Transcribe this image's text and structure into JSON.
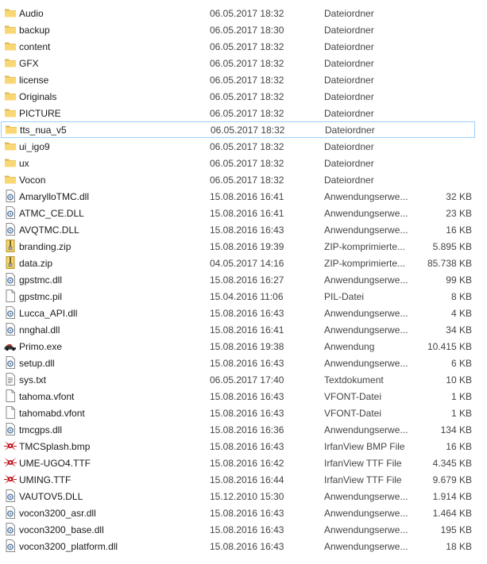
{
  "files": [
    {
      "name": "Audio",
      "date": "06.05.2017 18:32",
      "type": "Dateiordner",
      "size": "",
      "icon": "folder-icon"
    },
    {
      "name": "backup",
      "date": "06.05.2017 18:30",
      "type": "Dateiordner",
      "size": "",
      "icon": "folder-icon"
    },
    {
      "name": "content",
      "date": "06.05.2017 18:32",
      "type": "Dateiordner",
      "size": "",
      "icon": "folder-icon"
    },
    {
      "name": "GFX",
      "date": "06.05.2017 18:32",
      "type": "Dateiordner",
      "size": "",
      "icon": "folder-icon"
    },
    {
      "name": "license",
      "date": "06.05.2017 18:32",
      "type": "Dateiordner",
      "size": "",
      "icon": "folder-icon"
    },
    {
      "name": "Originals",
      "date": "06.05.2017 18:32",
      "type": "Dateiordner",
      "size": "",
      "icon": "folder-icon"
    },
    {
      "name": "PICTURE",
      "date": "06.05.2017 18:32",
      "type": "Dateiordner",
      "size": "",
      "icon": "folder-icon"
    },
    {
      "name": "tts_nua_v5",
      "date": "06.05.2017 18:32",
      "type": "Dateiordner",
      "size": "",
      "icon": "folder-icon",
      "selected": true
    },
    {
      "name": "ui_igo9",
      "date": "06.05.2017 18:32",
      "type": "Dateiordner",
      "size": "",
      "icon": "folder-icon"
    },
    {
      "name": "ux",
      "date": "06.05.2017 18:32",
      "type": "Dateiordner",
      "size": "",
      "icon": "folder-icon"
    },
    {
      "name": "Vocon",
      "date": "06.05.2017 18:32",
      "type": "Dateiordner",
      "size": "",
      "icon": "folder-icon"
    },
    {
      "name": "AmarylloTMC.dll",
      "date": "15.08.2016 16:41",
      "type": "Anwendungserwe...",
      "size": "32 KB",
      "icon": "dll-icon"
    },
    {
      "name": "ATMC_CE.DLL",
      "date": "15.08.2016 16:41",
      "type": "Anwendungserwe...",
      "size": "23 KB",
      "icon": "dll-icon"
    },
    {
      "name": "AVQTMC.DLL",
      "date": "15.08.2016 16:43",
      "type": "Anwendungserwe...",
      "size": "16 KB",
      "icon": "dll-icon"
    },
    {
      "name": "branding.zip",
      "date": "15.08.2016 19:39",
      "type": "ZIP-komprimierte...",
      "size": "5.895 KB",
      "icon": "zip-icon"
    },
    {
      "name": "data.zip",
      "date": "04.05.2017 14:16",
      "type": "ZIP-komprimierte...",
      "size": "85.738 KB",
      "icon": "zip-icon"
    },
    {
      "name": "gpstmc.dll",
      "date": "15.08.2016 16:27",
      "type": "Anwendungserwe...",
      "size": "99 KB",
      "icon": "dll-icon"
    },
    {
      "name": "gpstmc.pil",
      "date": "15.04.2016 11:06",
      "type": "PIL-Datei",
      "size": "8 KB",
      "icon": "file-icon"
    },
    {
      "name": "Lucca_API.dll",
      "date": "15.08.2016 16:43",
      "type": "Anwendungserwe...",
      "size": "4 KB",
      "icon": "dll-icon"
    },
    {
      "name": "nnghal.dll",
      "date": "15.08.2016 16:41",
      "type": "Anwendungserwe...",
      "size": "34 KB",
      "icon": "dll-icon"
    },
    {
      "name": "Primo.exe",
      "date": "15.08.2016 19:38",
      "type": "Anwendung",
      "size": "10.415 KB",
      "icon": "car-icon"
    },
    {
      "name": "setup.dll",
      "date": "15.08.2016 16:43",
      "type": "Anwendungserwe...",
      "size": "6 KB",
      "icon": "dll-icon"
    },
    {
      "name": "sys.txt",
      "date": "06.05.2017 17:40",
      "type": "Textdokument",
      "size": "10 KB",
      "icon": "text-file-icon"
    },
    {
      "name": "tahoma.vfont",
      "date": "15.08.2016 16:43",
      "type": "VFONT-Datei",
      "size": "1 KB",
      "icon": "file-icon"
    },
    {
      "name": "tahomabd.vfont",
      "date": "15.08.2016 16:43",
      "type": "VFONT-Datei",
      "size": "1 KB",
      "icon": "file-icon"
    },
    {
      "name": "tmcgps.dll",
      "date": "15.08.2016 16:36",
      "type": "Anwendungserwe...",
      "size": "134 KB",
      "icon": "dll-icon"
    },
    {
      "name": "TMCSplash.bmp",
      "date": "15.08.2016 16:43",
      "type": "IrfanView BMP File",
      "size": "16 KB",
      "icon": "irfanview-icon"
    },
    {
      "name": "UME-UGO4.TTF",
      "date": "15.08.2016 16:42",
      "type": "IrfanView TTF File",
      "size": "4.345 KB",
      "icon": "irfanview-icon"
    },
    {
      "name": "UMING.TTF",
      "date": "15.08.2016 16:44",
      "type": "IrfanView TTF File",
      "size": "9.679 KB",
      "icon": "irfanview-icon"
    },
    {
      "name": "VAUTOV5.DLL",
      "date": "15.12.2010 15:30",
      "type": "Anwendungserwe...",
      "size": "1.914 KB",
      "icon": "dll-icon"
    },
    {
      "name": "vocon3200_asr.dll",
      "date": "15.08.2016 16:43",
      "type": "Anwendungserwe...",
      "size": "1.464 KB",
      "icon": "dll-icon"
    },
    {
      "name": "vocon3200_base.dll",
      "date": "15.08.2016 16:43",
      "type": "Anwendungserwe...",
      "size": "195 KB",
      "icon": "dll-icon"
    },
    {
      "name": "vocon3200_platform.dll",
      "date": "15.08.2016 16:43",
      "type": "Anwendungserwe...",
      "size": "18 KB",
      "icon": "dll-icon"
    }
  ]
}
